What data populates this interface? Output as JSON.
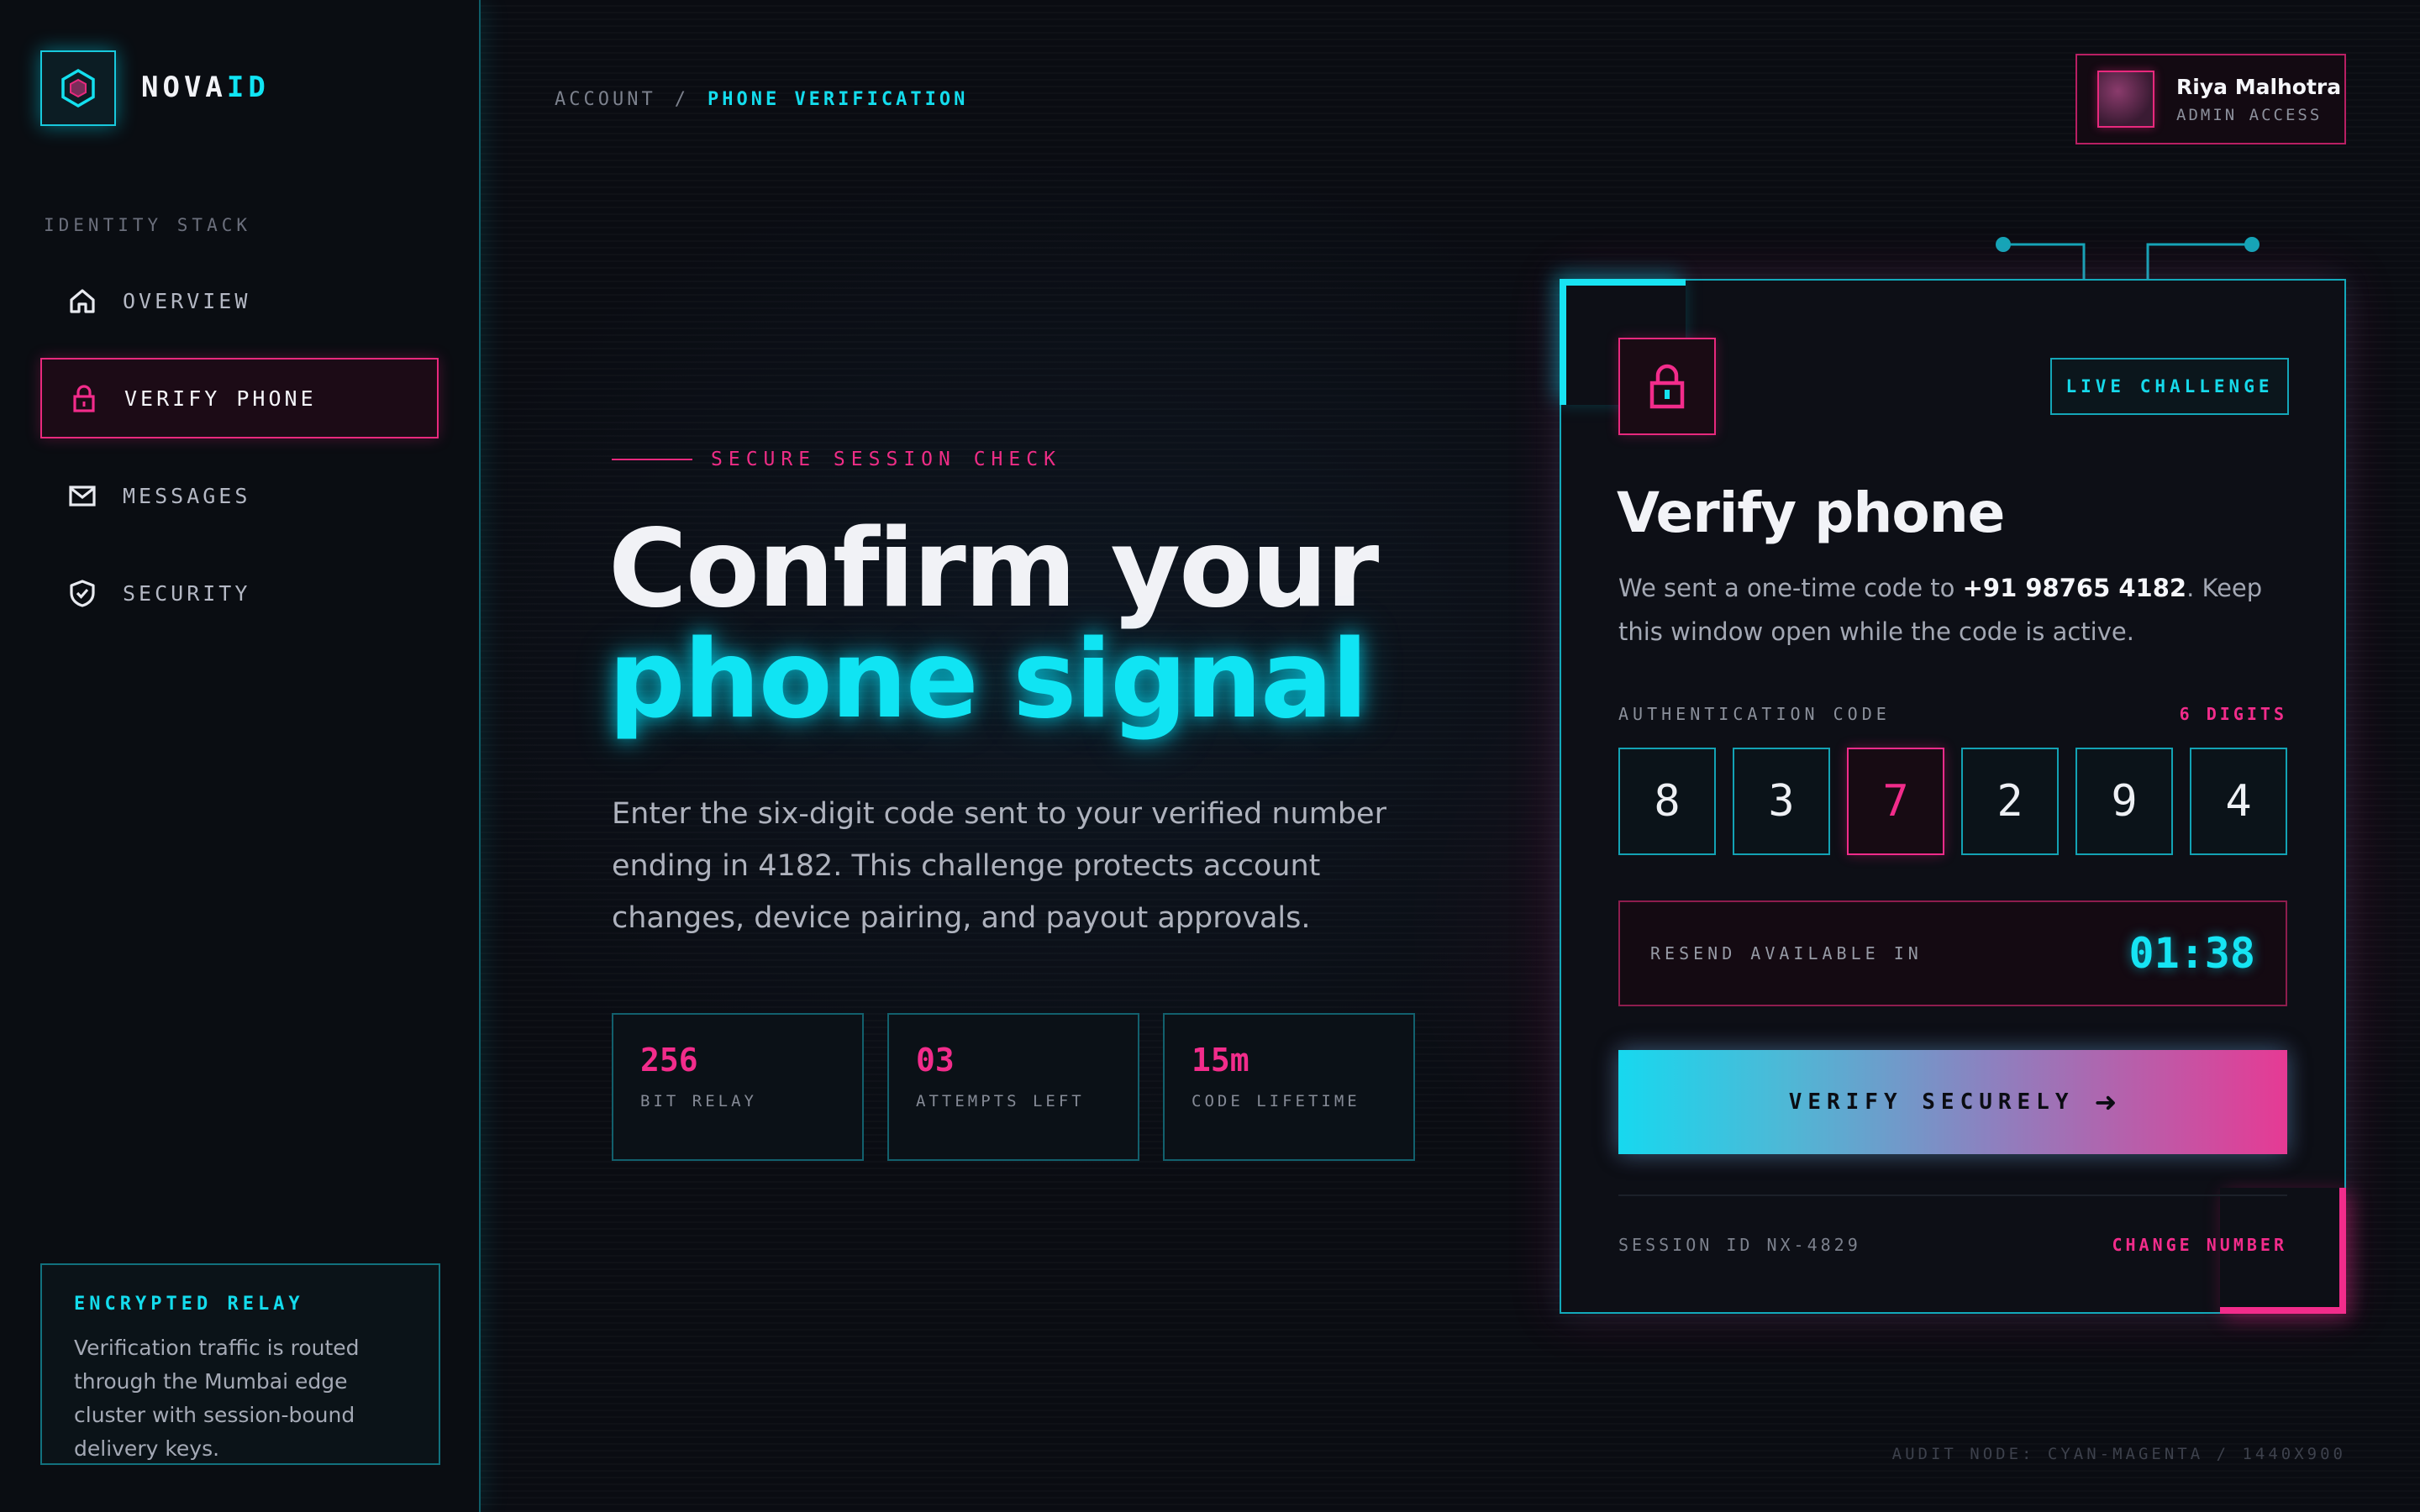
{
  "brand": {
    "name_prefix": "NOVA",
    "name_accent": "ID",
    "logo_icon": "hexagon-icon"
  },
  "sidebar": {
    "section_label": "IDENTITY STACK",
    "items": [
      {
        "label": "OVERVIEW",
        "icon": "home-icon",
        "active": false
      },
      {
        "label": "VERIFY PHONE",
        "icon": "lock-icon",
        "active": true
      },
      {
        "label": "MESSAGES",
        "icon": "mail-icon",
        "active": false
      },
      {
        "label": "SECURITY",
        "icon": "shield-check-icon",
        "active": false
      }
    ],
    "relay": {
      "title": "ENCRYPTED RELAY",
      "body": "Verification traffic is routed through the Mumbai edge cluster with session-bound delivery keys."
    }
  },
  "header": {
    "breadcrumb": {
      "parent": "ACCOUNT",
      "separator": "/",
      "current": "PHONE VERIFICATION"
    },
    "user": {
      "name": "Riya Malhotra",
      "role": "ADMIN ACCESS"
    }
  },
  "hero": {
    "eyebrow": "SECURE SESSION CHECK",
    "title_line1": "Confirm your",
    "title_line2": "phone signal",
    "lead": "Enter the six-digit code sent to your verified number ending in 4182. This challenge protects account changes, device pairing, and payout approvals.",
    "stats": [
      {
        "value": "256",
        "label": "BIT RELAY"
      },
      {
        "value": "03",
        "label": "ATTEMPTS LEFT"
      },
      {
        "value": "15m",
        "label": "CODE LIFETIME"
      }
    ]
  },
  "card": {
    "badge": "LIVE CHALLENGE",
    "title": "Verify phone",
    "desc_prefix": "We sent a one-time code to ",
    "phone": "+91 98765 4182",
    "desc_suffix": ". Keep this window open while the code is active.",
    "code_label": "AUTHENTICATION CODE",
    "code_count": "6 DIGITS",
    "digits": [
      "8",
      "3",
      "7",
      "2",
      "9",
      "4"
    ],
    "active_digit_index": 2,
    "resend_label": "RESEND AVAILABLE IN",
    "resend_timer": "01:38",
    "verify_label": "VERIFY SECURELY",
    "session_id": "SESSION ID NX-4829",
    "change_number": "CHANGE NUMBER"
  },
  "footer": {
    "audit": "AUDIT NODE: CYAN-MAGENTA / 1440X900"
  },
  "colors": {
    "cyan": "#10e4f3",
    "magenta": "#f22c8b",
    "background": "#0a0c12"
  }
}
